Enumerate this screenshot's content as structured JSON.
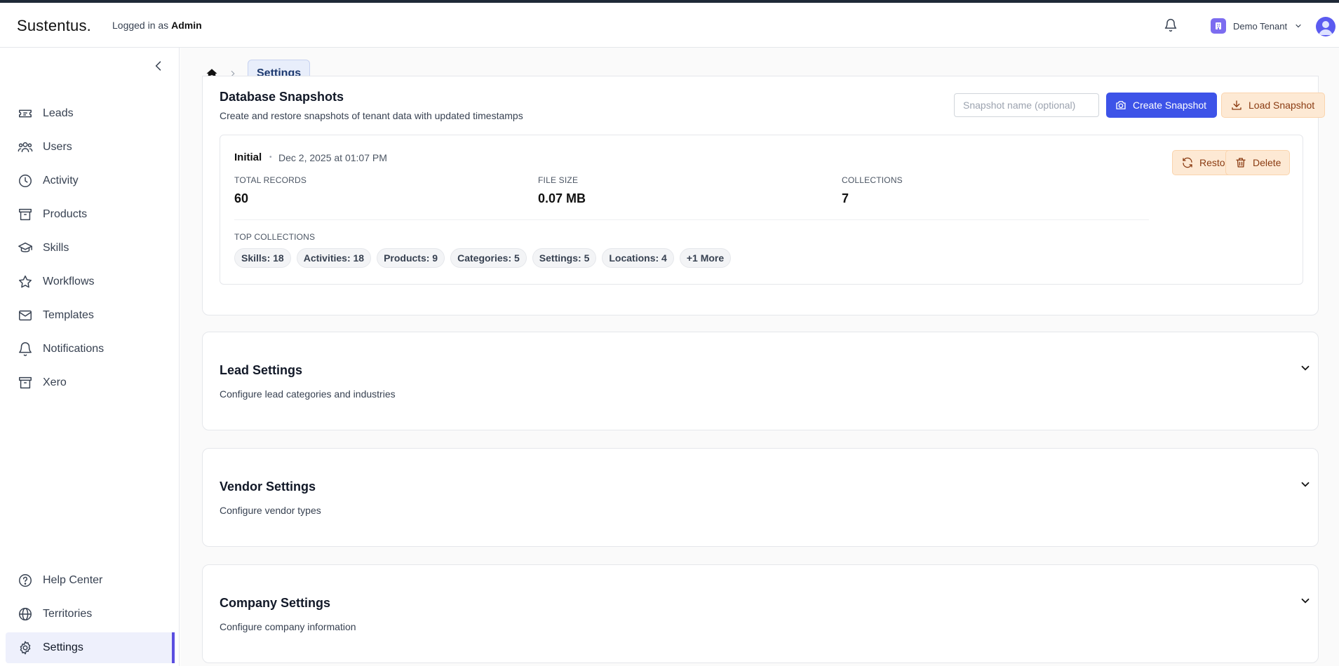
{
  "header": {
    "logo": "Sustentus.",
    "logged_prefix": "Logged in as",
    "logged_user": "Admin",
    "tenant_name": "Demo Tenant"
  },
  "sidebar": {
    "items": [
      {
        "label": "Leads",
        "icon": "ticket-icon"
      },
      {
        "label": "Users",
        "icon": "users-icon"
      },
      {
        "label": "Activity",
        "icon": "clock-icon"
      },
      {
        "label": "Products",
        "icon": "archive-icon"
      },
      {
        "label": "Skills",
        "icon": "graduation-cap-icon"
      },
      {
        "label": "Workflows",
        "icon": "star-icon"
      },
      {
        "label": "Templates",
        "icon": "mail-icon"
      },
      {
        "label": "Notifications",
        "icon": "bell-icon"
      },
      {
        "label": "Xero",
        "icon": "archive-icon"
      }
    ],
    "bottom_items": [
      {
        "label": "Help Center",
        "icon": "help-circle-icon"
      },
      {
        "label": "Territories",
        "icon": "globe-icon"
      },
      {
        "label": "Settings",
        "icon": "gear-icon",
        "active": true
      }
    ]
  },
  "breadcrumb": {
    "current": "Settings"
  },
  "snapshots": {
    "title": "Database Snapshots",
    "subtitle": "Create and restore snapshots of tenant data with updated timestamps",
    "input_placeholder": "Snapshot name (optional)",
    "create_label": "Create Snapshot",
    "load_label": "Load Snapshot",
    "snapshot": {
      "name": "Initial",
      "separator": "•",
      "date": "Dec 2, 2025 at 01:07 PM",
      "stats": [
        {
          "label": "TOTAL RECORDS",
          "value": "60"
        },
        {
          "label": "FILE SIZE",
          "value": "0.07 MB"
        },
        {
          "label": "COLLECTIONS",
          "value": "7"
        }
      ],
      "top_collections_label": "TOP COLLECTIONS",
      "chips": [
        "Skills: 18",
        "Activities: 18",
        "Products: 9",
        "Categories: 5",
        "Settings: 5",
        "Locations: 4",
        "+1 More"
      ],
      "restore_label": "Restore",
      "delete_label": "Delete"
    }
  },
  "sections": [
    {
      "title": "Lead Settings",
      "subtitle": "Configure lead categories and industries"
    },
    {
      "title": "Vendor Settings",
      "subtitle": "Configure vendor types"
    },
    {
      "title": "Company Settings",
      "subtitle": "Configure company information"
    }
  ],
  "colors": {
    "primary": "#3d53e8",
    "accent": "#5b4fe0",
    "warning_bg": "#fde9d4",
    "warning_text": "#8a3b12"
  }
}
